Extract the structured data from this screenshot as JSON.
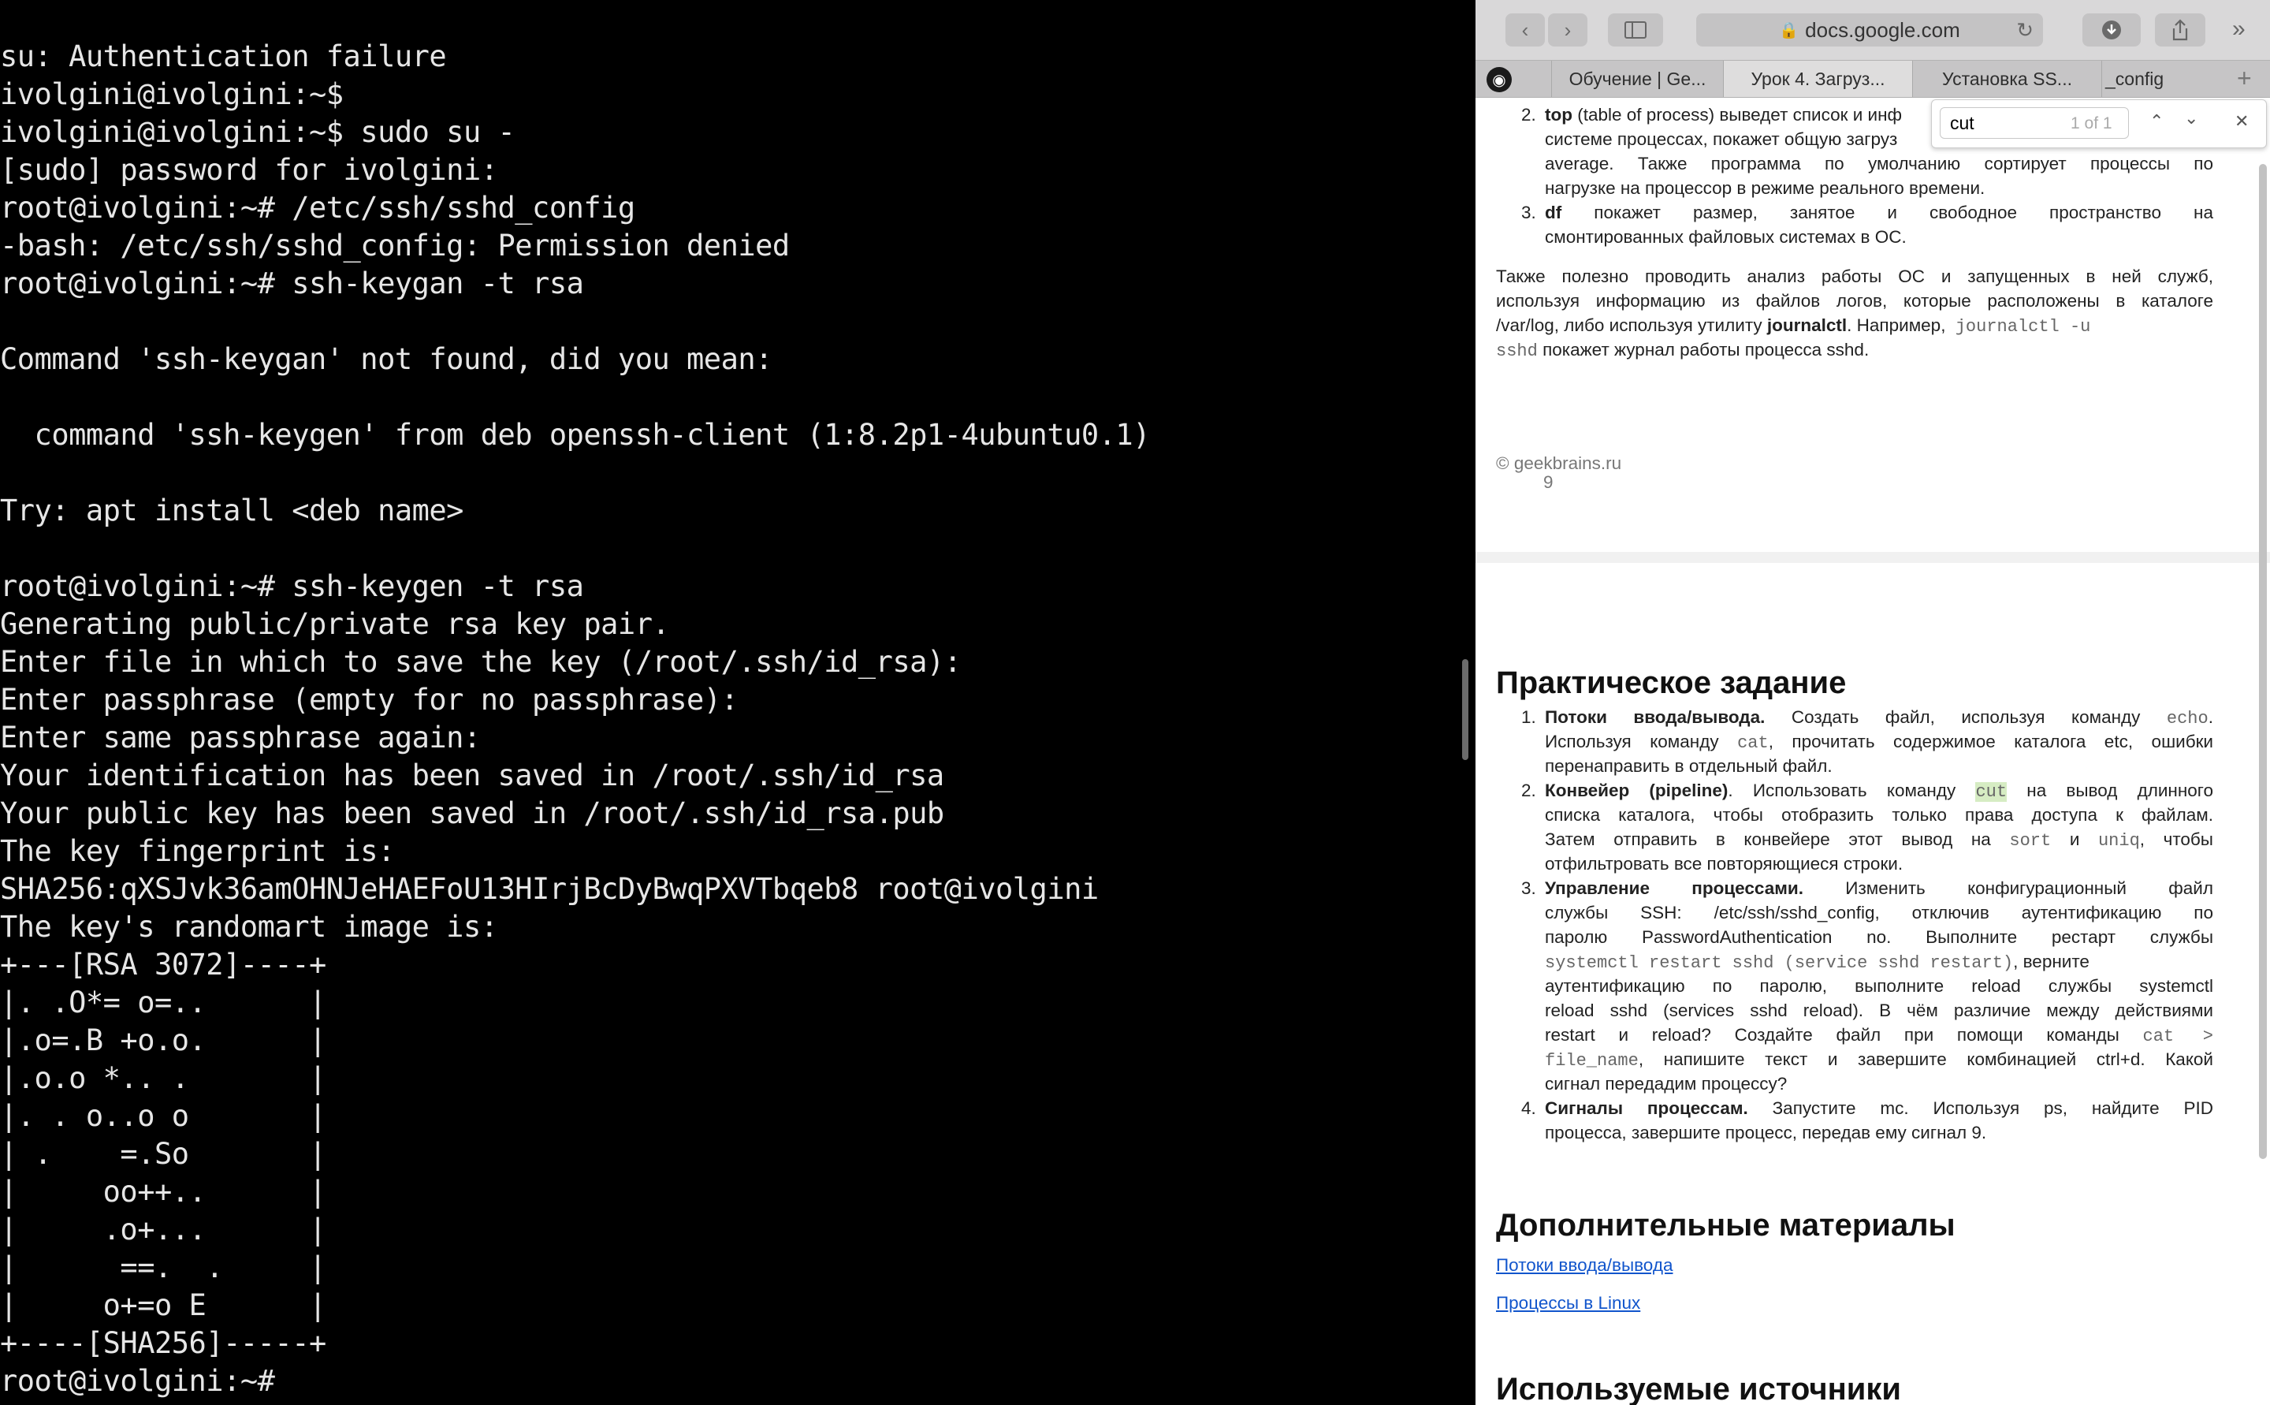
{
  "terminal": {
    "lines": [
      "su: Authentication failure",
      "ivolgini@ivolgini:~$",
      "ivolgini@ivolgini:~$ sudo su -",
      "[sudo] password for ivolgini:",
      "root@ivolgini:~# /etc/ssh/sshd_config",
      "-bash: /etc/ssh/sshd_config: Permission denied",
      "root@ivolgini:~# ssh-keygan -t rsa",
      "",
      "Command 'ssh-keygan' not found, did you mean:",
      "",
      "  command 'ssh-keygen' from deb openssh-client (1:8.2p1-4ubuntu0.1)",
      "",
      "Try: apt install <deb name>",
      "",
      "root@ivolgini:~# ssh-keygen -t rsa",
      "Generating public/private rsa key pair.",
      "Enter file in which to save the key (/root/.ssh/id_rsa):",
      "Enter passphrase (empty for no passphrase):",
      "Enter same passphrase again:",
      "Your identification has been saved in /root/.ssh/id_rsa",
      "Your public key has been saved in /root/.ssh/id_rsa.pub",
      "The key fingerprint is:",
      "SHA256:qXSJvk36amOHNJeHAEFoU13HIrjBcDyBwqPXVTbqeb8 root@ivolgini",
      "The key's randomart image is:",
      "+---[RSA 3072]----+",
      "|. .O*= o=..      |",
      "|.o=.B +o.o.      |",
      "|.o.o *.. .       |",
      "|. . o..o o       |",
      "| .    =.So       |",
      "|     oo++..      |",
      "|     .o+...      |",
      "|      ==.  .     |",
      "|     o+=o E      |",
      "+----[SHA256]-----+",
      "root@ivolgini:~#"
    ]
  },
  "browser": {
    "address": "docs.google.com",
    "tabs": [
      {
        "label": "Обучение | Ge..."
      },
      {
        "label": "Урок 4. Загруз..."
      },
      {
        "label": "Установка SS..."
      },
      {
        "label": "_config"
      }
    ],
    "find": {
      "query": "cut",
      "count": "1 of 1"
    }
  },
  "doc": {
    "top_list": {
      "item2_bold": "top",
      "item2_line1": "(table of process) выведет список и инф",
      "item2_line2": "системе процессах, покажет общую загруз",
      "item2_line3": "average. Также программа по умолчанию сортирует процессы по",
      "item2_line4": "нагрузке на процессор в режиме реального времени.",
      "item3_bold": "df",
      "item3_line1": "покажет размер, занятое и свободное пространство на",
      "item3_line2": "смонтированных файловых системах в ОС."
    },
    "para_logs": {
      "line1": "Также полезно проводить анализ работы ОС и запущенных в ней служб,",
      "line2": "используя информацию из файлов логов, которые расположены в каталоге",
      "line3a": "/var/log, либо используя утилиту",
      "line3b": "journalctl",
      "line3c": ". Например,",
      "line3code": "journalctl -u",
      "line4code": "sshd",
      "line4rest": "покажет журнал работы процесса sshd."
    },
    "footer": {
      "copyright": "© geekbrains.ru",
      "page": "9"
    },
    "practice": {
      "heading": "Практическое задание",
      "item1": {
        "bold": "Потоки ввода/вывода.",
        "l1": "Создать файл, используя команду",
        "code1": "echo",
        "l2a": "Используя команду",
        "code2": "cat",
        "l2b": ", прочитать содержимое каталога etc, ошибки",
        "l3": "перенаправить в отдельный файл."
      },
      "item2": {
        "bold": "Конвейер (pipeline)",
        "l1a": ". Использовать команду",
        "code1": "cut",
        "l1b": "на вывод длинного",
        "l2": "списка каталога, чтобы отобразить только права доступа к файлам.",
        "l3a": "Затем отправить в конвейере этот вывод на",
        "code2": "sort",
        "l3b": "и",
        "code3": "uniq",
        "l3c": ", чтобы",
        "l4": "отфильтровать все повторяющиеся строки."
      },
      "item3": {
        "bold": "Управление процессами.",
        "l1": "Изменить конфигурационный файл",
        "l2": "службы SSH: /etc/ssh/sshd_config, отключив аутентификацию по",
        "l3": "паролю PasswordAuthentication no. Выполните рестарт службы",
        "code1": "systemctl restart sshd (service sshd restart)",
        "l4b": ", верните",
        "l5": "аутентификацию по паролю, выполните reload службы systemctl",
        "l6": "reload sshd (services sshd reload). В чём различие между действиями",
        "l7a": "restart и reload? Создайте файл при помощи команды",
        "code2": "cat >",
        "code3": "file_name",
        "l8b": ", напишите текст и завершите комбинацией ctrl+d. Какой",
        "l9": "сигнал передадим процессу?"
      },
      "item4": {
        "bold": "Сигналы процессам.",
        "l1": "Запустите mc. Используя ps, найдите PID",
        "l2": "процесса, завершите процесс, передав ему сигнал 9."
      }
    },
    "additional": {
      "heading": "Дополнительные материалы",
      "link1": "Потоки ввода/вывода",
      "link2": "Процессы в Linux"
    },
    "sources_heading": "Используемые источники"
  }
}
